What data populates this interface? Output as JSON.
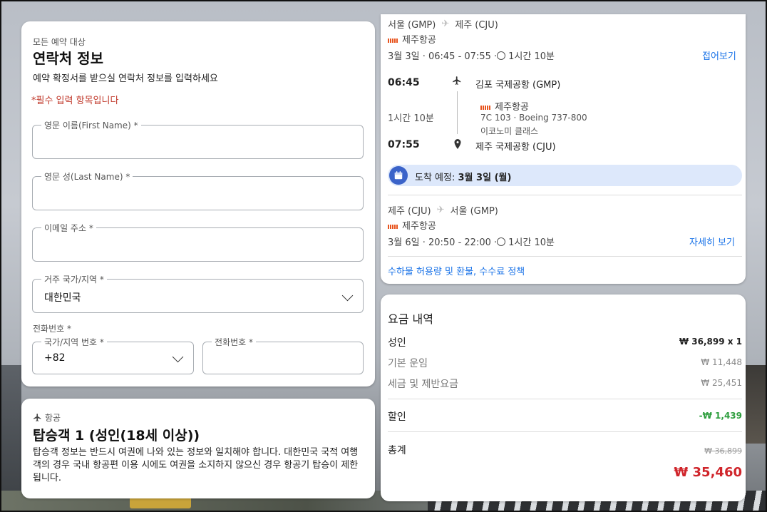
{
  "contact": {
    "eyebrow": "모든 예약 대상",
    "title": "연락처 정보",
    "subtitle": "예약 확정서를 받으실 연락처 정보를 입력하세요",
    "required_note": "*필수 입력 항목입니다",
    "first_name_label": "영문 이름(First Name) *",
    "last_name_label": "영문 성(Last Name) *",
    "email_label": "이메일 주소 *",
    "country_label": "거주 국가/지역 *",
    "country_value": "대한민국",
    "phone_group_label": "전화번호 *",
    "phone_code_label": "국가/지역 번호 *",
    "phone_code_value": "+82",
    "phone_number_label": "전화번호 *"
  },
  "passenger": {
    "eyebrow": "항공",
    "title": "탑승객 1 (성인(18세 이상))",
    "description": "탑승객 정보는 반드시 여권에 나와 있는 정보와 일치해야 합니다. 대한민국 국적 여행객의 경우 국내 항공편 이용 시에도 여권을 소지하지 않으신 경우 항공기 탑승이 제한됩니다."
  },
  "outbound": {
    "route_from": "서울 (GMP)",
    "route_to": "제주 (CJU)",
    "airline": "제주항공",
    "summary": "3월 3일 · 06:45 - 07:55 · ",
    "duration_text": "1시간 10분",
    "collapse_link": "접어보기",
    "dep_time": "06:45",
    "dep_airport": "김포 국제공항 (GMP)",
    "segment_duration": "1시간 10분",
    "segment_airline": "제주항공",
    "flight_info": "7C 103 · Boeing 737-800",
    "cabin": "이코노미 클래스",
    "arr_time": "07:55",
    "arr_airport": "제주 국제공항 (CJU)",
    "arrival_label": "도착 예정: ",
    "arrival_date": "3월 3일 (월)"
  },
  "return": {
    "route_from": "제주 (CJU)",
    "route_to": "서울 (GMP)",
    "airline": "제주항공",
    "summary": "3월 6일 · 20:50 - 22:00 · ",
    "duration_text": "1시간 10분",
    "details_link": "자세히 보기"
  },
  "policy_link": "수하물 허용량 및 환불, 수수료 정책",
  "pricing": {
    "title": "요금 내역",
    "adult_label": "성인",
    "adult_value": "₩ 36,899 x 1",
    "base_fare_label": "기본 운임",
    "base_fare_value": "₩ 11,448",
    "taxes_label": "세금 및 제반요금",
    "taxes_value": "₩ 25,451",
    "discount_label": "할인",
    "discount_value": "-₩ 1,439",
    "total_label": "총계",
    "total_original": "₩ 36,899",
    "total_value": "₩ 35,460"
  },
  "colors": {
    "link": "#1a73e8",
    "required": "#c0392b",
    "discount": "#2e9e3e",
    "total": "#d0252b",
    "arrival_banner": "#dde8fb"
  }
}
